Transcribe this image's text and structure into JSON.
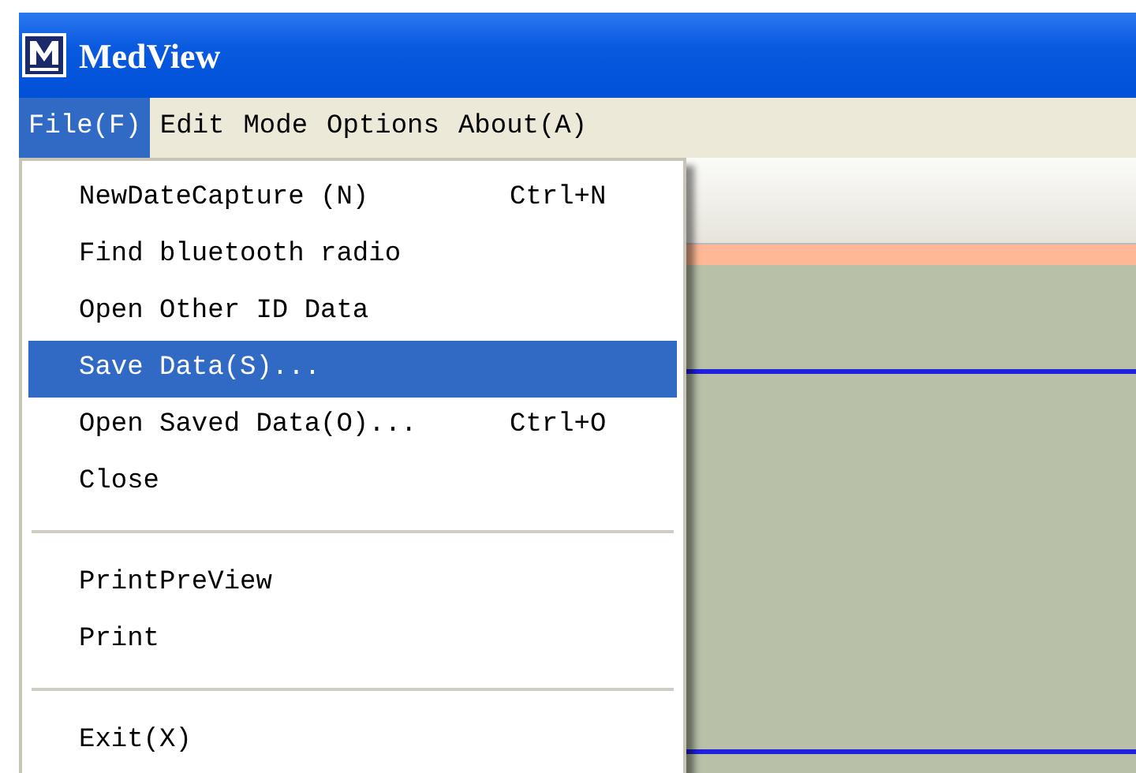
{
  "window": {
    "title": "MedView"
  },
  "menu_bar": [
    {
      "label": "File(F)",
      "selected": true
    },
    {
      "label": "Edit",
      "selected": false
    },
    {
      "label": "Mode",
      "selected": false
    },
    {
      "label": "Options",
      "selected": false
    },
    {
      "label": "About(A)",
      "selected": false
    }
  ],
  "file_menu": [
    {
      "kind": "item",
      "label": "NewDateCapture (N)",
      "shortcut": "Ctrl+N",
      "selected": false
    },
    {
      "kind": "item",
      "label": "Find bluetooth radio",
      "selected": false
    },
    {
      "kind": "item",
      "label": "Open Other ID Data",
      "selected": false
    },
    {
      "kind": "item",
      "label": "Save Data(S)...",
      "selected": true
    },
    {
      "kind": "item",
      "label": "Open Saved Data(O)...",
      "shortcut": "Ctrl+O",
      "selected": false
    },
    {
      "kind": "item",
      "label": "Close",
      "selected": false
    },
    {
      "kind": "separator"
    },
    {
      "kind": "item",
      "label": "PrintPreView",
      "selected": false
    },
    {
      "kind": "item",
      "label": "Print",
      "selected": false
    },
    {
      "kind": "separator"
    },
    {
      "kind": "item",
      "label": "Exit(X)",
      "selected": false
    }
  ]
}
